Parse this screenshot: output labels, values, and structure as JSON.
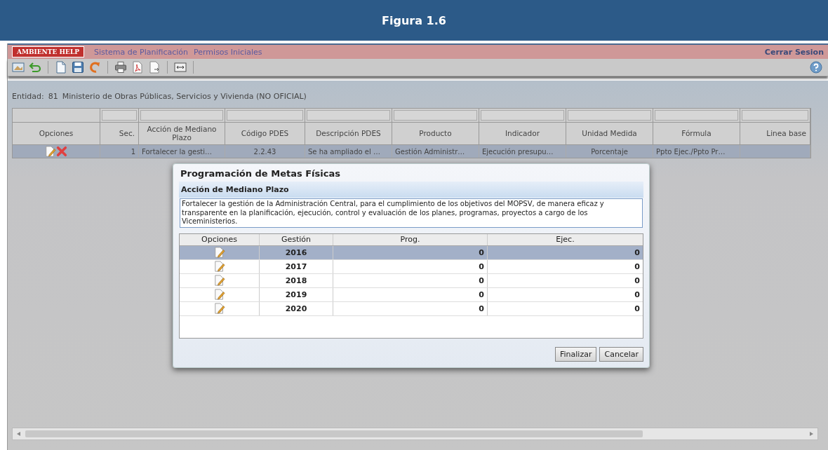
{
  "banner": {
    "title": "Figura 1.6"
  },
  "menu_bar": {
    "brand": "AMBIENTE HELP",
    "menus": [
      "Sistema de Planificación",
      "Permisos Iniciales"
    ],
    "logout": "Cerrar Sesion"
  },
  "entity": {
    "label": "Entidad:",
    "code": "81",
    "name": "Ministerio de Obras Públicas, Servicios y Vivienda (NO OFICIAL)"
  },
  "grid": {
    "columns": [
      "Opciones",
      "Sec.",
      "Acción de Mediano Plazo",
      "Código PDES",
      "Descripción PDES",
      "Producto",
      "Indicador",
      "Unidad Medida",
      "Fórmula",
      "Linea base"
    ],
    "rows": [
      {
        "selected": true,
        "cells": [
          "",
          "1",
          "Fortalecer la gesti…",
          "2.2.43",
          "Se ha ampliado el …",
          "Gestión Administr…",
          "Ejecución presupu…",
          "Porcentaje",
          "Ppto Ejec./Ppto Pr…",
          ""
        ]
      }
    ]
  },
  "dialog": {
    "title": "Programación de Metas Físicas",
    "section": "Acción de Mediano Plazo",
    "description": "Fortalecer la gestión de la Administración Central, para el cumplimiento de los objetivos del MOPSV, de manera eficaz y transparente en la planificación, ejecución, control y evaluación de los planes, programas, proyectos a cargo de los Viceministerios.",
    "columns": [
      "Opciones",
      "Gestión",
      "Prog.",
      "Ejec."
    ],
    "rows": [
      {
        "gestion": "2016",
        "prog": "0",
        "ejec": "0",
        "selected": true
      },
      {
        "gestion": "2017",
        "prog": "0",
        "ejec": "0",
        "selected": false
      },
      {
        "gestion": "2018",
        "prog": "0",
        "ejec": "0",
        "selected": false
      },
      {
        "gestion": "2019",
        "prog": "0",
        "ejec": "0",
        "selected": false
      },
      {
        "gestion": "2020",
        "prog": "0",
        "ejec": "0",
        "selected": false
      }
    ],
    "buttons": [
      "Finalizar",
      "Cancelar"
    ]
  }
}
